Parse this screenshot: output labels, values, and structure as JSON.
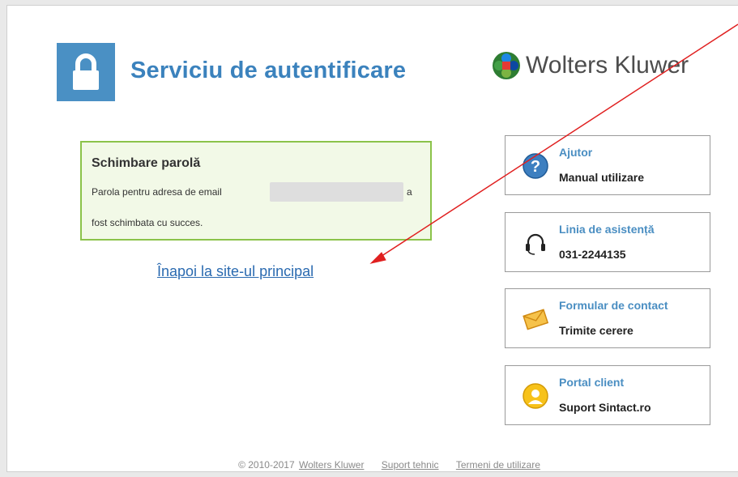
{
  "header": {
    "title": "Serviciu de autentificare",
    "brand": "Wolters Kluwer"
  },
  "message": {
    "title": "Schimbare parolă",
    "line1": "Parola pentru adresa de email",
    "line1_end": "a",
    "line2": "fost schimbata cu succes."
  },
  "back_link": "Înapoi la site-ul principal",
  "sidebar": {
    "cards": [
      {
        "title": "Ajutor",
        "subtitle": "Manual utilizare",
        "icon": "help-icon"
      },
      {
        "title": "Linia de asistență",
        "subtitle": "031-2244135",
        "icon": "headset-icon"
      },
      {
        "title": "Formular de contact",
        "subtitle": "Trimite cerere",
        "icon": "envelope-icon"
      },
      {
        "title": "Portal client",
        "subtitle": "Suport Sintact.ro",
        "icon": "portal-user-icon"
      }
    ]
  },
  "footer": {
    "copyright": "© 2010-2017",
    "link_company": "Wolters Kluwer",
    "link_support": "Suport tehnic",
    "link_terms": "Termeni de utilizare"
  },
  "colors": {
    "accent": "#3b82bd",
    "success_border": "#8bc34a",
    "annotation": "#e02020"
  }
}
